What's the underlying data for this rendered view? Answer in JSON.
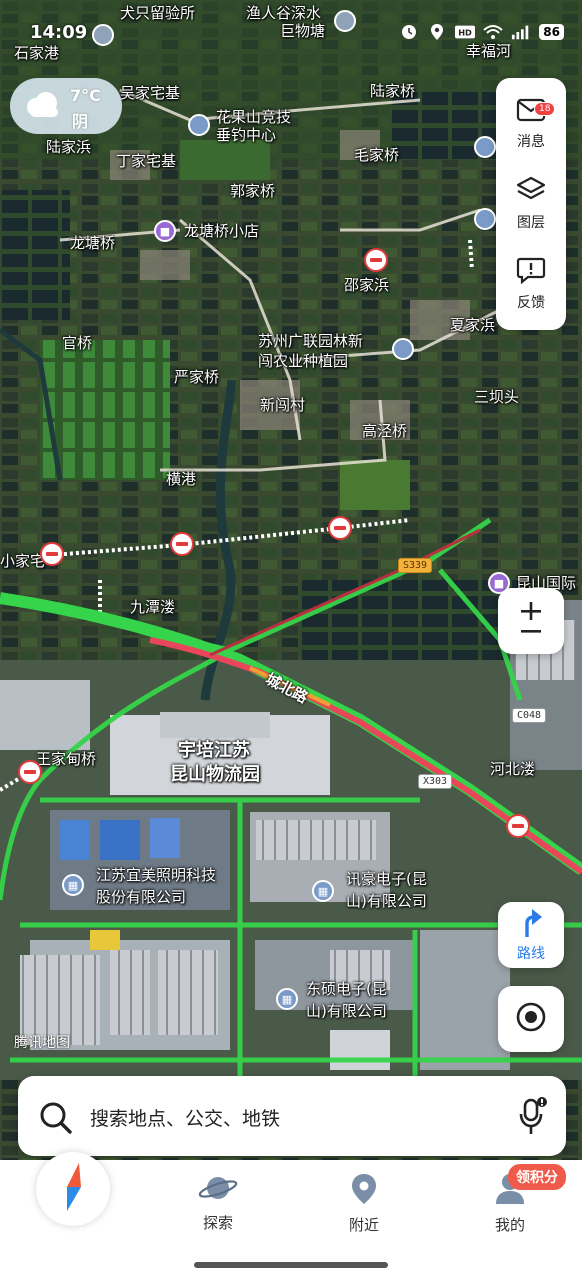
{
  "status_bar": {
    "time": "14:09",
    "battery": "86"
  },
  "weather": {
    "temp": "7°C",
    "condition": "阴"
  },
  "map": {
    "places": [
      {
        "id": "p-shijiagang",
        "text": "石家港"
      },
      {
        "id": "p-quanzhidian",
        "text": "犬只留验所"
      },
      {
        "id": "p-yurengu",
        "text": "渔人谷深水"
      },
      {
        "id": "p-guwutang",
        "text": "巨物塘"
      },
      {
        "id": "p-xingfuhe",
        "text": "幸福河"
      },
      {
        "id": "p-wujiazhai",
        "text": "吴家宅基"
      },
      {
        "id": "p-lujiaqiao",
        "text": "陆家桥"
      },
      {
        "id": "p-huaguoshan",
        "text": "花果山竞技"
      },
      {
        "id": "p-chuidiao",
        "text": "垂钓中心"
      },
      {
        "id": "p-lujiabang",
        "text": "陆家浜"
      },
      {
        "id": "p-dingjiazhai",
        "text": "丁家宅基"
      },
      {
        "id": "p-maojiaqiao",
        "text": "毛家桥"
      },
      {
        "id": "p-guojiaqiao",
        "text": "郭家桥"
      },
      {
        "id": "p-longtangqiao",
        "text": "龙塘桥"
      },
      {
        "id": "p-shaojiabang",
        "text": "邵家浜"
      },
      {
        "id": "p-guanqiao",
        "text": "官桥"
      },
      {
        "id": "p-guanglian1",
        "text": "苏州广联园林新"
      },
      {
        "id": "p-guanglian2",
        "text": "闯农业种植园"
      },
      {
        "id": "p-xiajiabang",
        "text": "夏家浜"
      },
      {
        "id": "p-yanjiaqiao",
        "text": "严家桥"
      },
      {
        "id": "p-sanbatou",
        "text": "三坝头"
      },
      {
        "id": "p-xinchuangcun",
        "text": "新闯村"
      },
      {
        "id": "p-gaojingqiao",
        "text": "高泾桥"
      },
      {
        "id": "p-henggang",
        "text": "横港"
      },
      {
        "id": "p-jiajiazhai",
        "text": "小家宅"
      },
      {
        "id": "p-jiutanlou",
        "text": "九潭溇"
      },
      {
        "id": "p-wangjiadian",
        "text": "王家甸桥"
      },
      {
        "id": "p-hebeilou",
        "text": "河北溇"
      }
    ],
    "pois": [
      {
        "id": "poi-longtang-store",
        "text": "龙塘桥小店"
      },
      {
        "id": "poi-kunshan",
        "text": "昆山国际"
      }
    ],
    "areas": [
      {
        "id": "a-yupei1",
        "text": "宇培江苏"
      },
      {
        "id": "a-yupei2",
        "text": "昆山物流园"
      },
      {
        "id": "a-yimei1",
        "text": "江苏宜美照明科技"
      },
      {
        "id": "a-yimei2",
        "text": "股份有限公司"
      },
      {
        "id": "a-xunhao1",
        "text": "讯豪电子(昆"
      },
      {
        "id": "a-xunhao2",
        "text": "山)有限公司"
      },
      {
        "id": "a-dongshuo1",
        "text": "东硕电子(昆"
      },
      {
        "id": "a-dongshuo2",
        "text": "山)有限公司"
      }
    ],
    "road_name": "城北路",
    "shields": {
      "s339": "S339",
      "c048": "C048",
      "x303": "X303"
    },
    "watermark": "腾讯地图"
  },
  "tools": {
    "messages_label": "消息",
    "messages_badge": "18",
    "layers_label": "图层",
    "feedback_label": "反馈",
    "route_label": "路线"
  },
  "search": {
    "placeholder": "搜索地点、公交、地铁"
  },
  "nav": {
    "explore": "探索",
    "nearby": "附近",
    "mine": "我的",
    "points": "领积分"
  },
  "colors": {
    "accent": "#2b7be6",
    "road_green": "#35d44a",
    "road_red": "#e8465a",
    "badge_red": "#f04040"
  }
}
